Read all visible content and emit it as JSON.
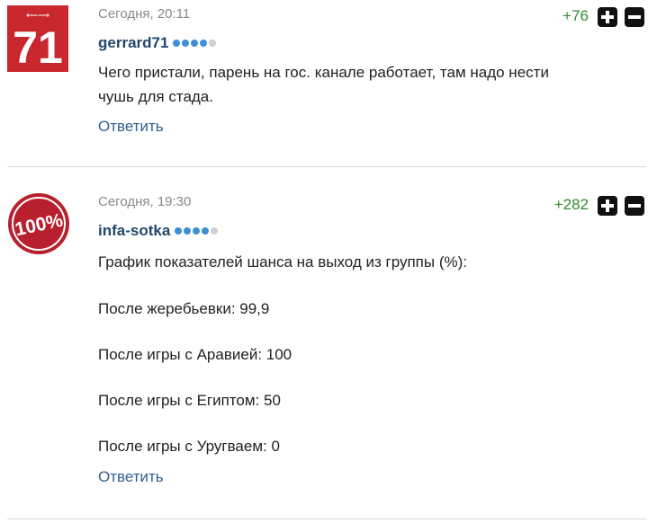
{
  "comments": [
    {
      "time": "Сегодня, 20:11",
      "username": "gerrard71",
      "score": "+76",
      "avatar_text": "71",
      "rating": [
        true,
        true,
        true,
        true,
        false
      ],
      "lines": [
        "Чего пристали, парень на гос. канале работает, там надо нести",
        "чушь для стада."
      ],
      "reply_label": "Ответить"
    },
    {
      "time": "Сегодня, 19:30",
      "username": "infa-sotka",
      "score": "+282",
      "avatar_text": "100%",
      "rating": [
        true,
        true,
        true,
        true,
        false
      ],
      "lines": [
        "График показателей шанса на выход из группы (%):",
        "После жеребьевки: 99,9",
        "После игры с Аравией: 100",
        "После игры с Египтом: 50",
        "После игры с Уругваем: 0"
      ],
      "reply_label": "Ответить"
    }
  ],
  "colors": {
    "dot_active": "#3d8fd6",
    "dot_inactive": "#cfcfcf",
    "score_positive": "#2e8b2e",
    "username": "#23476b",
    "reply_link": "#2f5f8f",
    "avatar1_bg": "#c8282d",
    "avatar2_bg": "#b8202e"
  }
}
